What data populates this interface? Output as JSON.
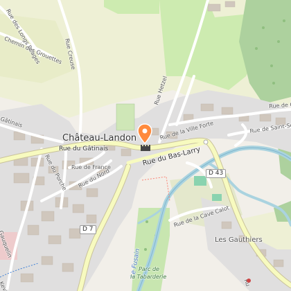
{
  "map": {
    "place_labels": {
      "town": "Château-Landon",
      "hamlet": "Les Gauthiers"
    },
    "street_labels": {
      "rue_des_longs_reages": "Rue des Longs Réages",
      "chemin_des_grouettes": "Chemin des Grouettes",
      "rue_creuse": "Rue Creuse",
      "rue_hetzel": "Rue Hetzel",
      "rue_de_la_ville_forte": "Rue de la Ville Forte",
      "rue_du_bas_larry": "Rue du Bas-Larry",
      "rue_de_saint_se": "Rue de Saint-Sé",
      "rue_de_c": "Rue de C",
      "gatinais": "Gâtinais",
      "rue_du_gatinais": "Rue du Gâtinais",
      "rue_de_france": "Rue de France",
      "rue_du_porche": "Rue du Porche",
      "rue_du_nord": "Rue du Nord",
      "rue_de_la_cave_calot": "Rue de la Cave Calot",
      "gauquelin": "Gauquelin",
      "keville": "Keville",
      "rue_bottom": "Ru"
    },
    "road_refs": {
      "d43": "D 43",
      "d7": "D 7"
    },
    "water_labels": {
      "le_fusain": "Le Fusain"
    },
    "park_labels": {
      "parc_line1": "Parc de",
      "parc_line2": "la Tabarderie"
    },
    "poi": {
      "marker_icon": "map-pin-icon",
      "castle_icon": "castle-icon",
      "marker_color": "#ff8a3c"
    },
    "colors": {
      "background": "#f2efe9",
      "farmland": "#eef0d5",
      "grass": "#cdebb0",
      "forest": "#add19e",
      "water": "#aad3df",
      "residential": "#e0dfdf",
      "road_major": "#f7fabf",
      "road_casing": "#c9c29a",
      "road_minor": "#ffffff"
    }
  }
}
